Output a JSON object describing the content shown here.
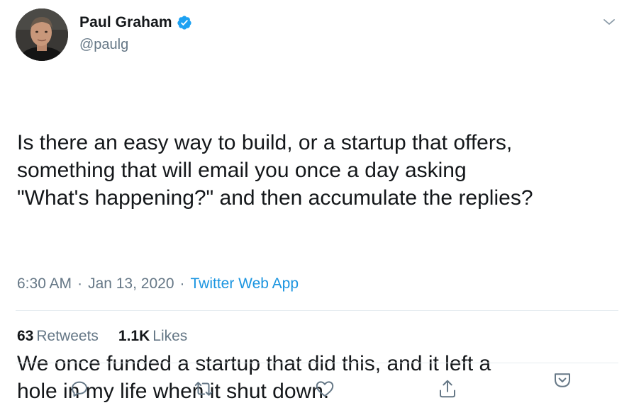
{
  "author": {
    "display_name": "Paul Graham",
    "handle": "@paulg",
    "verified": true,
    "avatar_icon": "person-avatar"
  },
  "tweet": {
    "paragraph_1": "Is there an easy way to build, or a startup that offers,\nsomething that will email you once a day asking\n\"What's happening?\" and then accumulate the replies?",
    "paragraph_2": "We once funded a startup that did this, and it left a\nhole in my life when it shut down."
  },
  "meta": {
    "time": "6:30 AM",
    "separator": "·",
    "date": "Jan 13, 2020",
    "source": "Twitter Web App"
  },
  "stats": {
    "retweets_count": "63",
    "retweets_label": "Retweets",
    "likes_count": "1.1K",
    "likes_label": "Likes"
  },
  "actions": [
    {
      "icon": "reply-icon"
    },
    {
      "icon": "retweet-icon"
    },
    {
      "icon": "heart-icon"
    },
    {
      "icon": "share-icon"
    },
    {
      "icon": "save-icon"
    }
  ],
  "colors": {
    "text": "#14171a",
    "secondary": "#657786",
    "link": "#1b95e0",
    "verified": "#1da1f2",
    "divider": "#e6ecf0"
  }
}
